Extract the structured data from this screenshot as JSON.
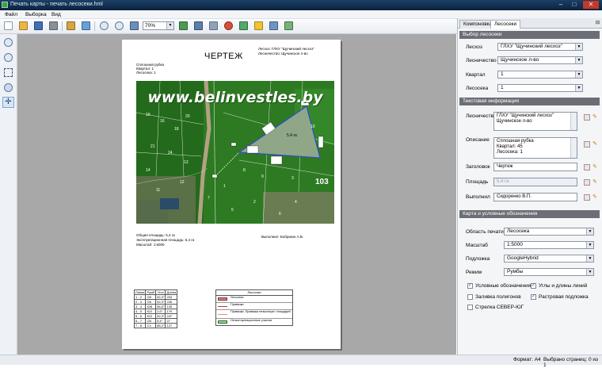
{
  "window": {
    "title": "Печать карты - печать лесосеки.hml",
    "minimize": "–",
    "maximize": "□",
    "close": "✕"
  },
  "menu": [
    "Файл",
    "Выборка",
    "Вид"
  ],
  "toolbar": {
    "zoom_value": "70%"
  },
  "page": {
    "heading": "ЧЕРТЕЖ",
    "leshoz_line": "Лесхоз: ГЛХУ \"Щучинский лесхоз\"",
    "lesnichestvo_line": "Лесничество: Щучинское л-во",
    "desc_lines": [
      "Сплошная рубка",
      "Квартал: 1",
      "Лесосека: 1"
    ],
    "watermark": "www.belinvestles.by",
    "map_labels": [
      "19",
      "16",
      "18",
      "20",
      "21",
      "24",
      "14",
      "13",
      "12",
      "11",
      "1",
      "2",
      "3",
      "4",
      "5",
      "6",
      "7",
      "8",
      "9",
      "10",
      "103",
      "5,4 га"
    ],
    "area_total": "Общая площадь: 5,4 га",
    "area_expl": "Эксплуатационная площадь: 5,4 га",
    "scale": "Масштаб: 1:5000",
    "executor": "Выполнил: Бобрикок А.В.",
    "bearing_table": {
      "headers": [
        "Линия",
        "Румб",
        "Угол",
        "Длина"
      ],
      "rows": [
        [
          "1 - 2",
          "СВ",
          "52,3°",
          "203"
        ],
        [
          "2 - 3",
          "СВ",
          "52,3°",
          "226"
        ],
        [
          "3 - 4",
          "ЮВ",
          "56,5°",
          "139"
        ],
        [
          "4 - 5",
          "ЮЗ",
          "2,5°",
          "179"
        ],
        [
          "5 - 6",
          "ЮЗ",
          "52,3°",
          "247"
        ],
        [
          "6 - 7",
          "СВ",
          "5,4°",
          "27"
        ],
        [
          "7 - 8",
          "СЗ",
          "88,2°",
          "127"
        ]
      ]
    },
    "legend": {
      "title": "Лесосеки",
      "items": [
        "Лесосеки",
        "Привязки",
        "Привязки. Привязки неэксплуат. площадей",
        "Неэксплуатационные участки"
      ]
    }
  },
  "panel": {
    "tabs": [
      "Компоновка",
      "Лесосеки"
    ],
    "sections": {
      "select": "Выбор лесосеки",
      "text_info": "Текстовая информация",
      "map": "Карта и условные обозначения"
    },
    "select_fields": [
      {
        "label": "Лесхоз",
        "value": "ГЛХУ \"Щучинский лесхоз\""
      },
      {
        "label": "Лесничество",
        "value": "Щучинское л-во"
      },
      {
        "label": "Квартал",
        "value": "1"
      },
      {
        "label": "Лесосека",
        "value": "1"
      }
    ],
    "text_fields": {
      "lesnichestvo_label": "Лесничество",
      "lesnichestvo_value_1": "ГЛХУ \"Щучинский лесхоз\"",
      "lesnichestvo_value_2": "Щучинское л-во",
      "opisanie_label": "Описание",
      "opisanie_lines": [
        "Сплошная рубка",
        "Квартал: 45",
        "Лесосека: 1"
      ],
      "zagolovok_label": "Заголовок",
      "zagolovok_value": "Чертеж",
      "ploshad_label": "Площадь",
      "ploshad_value": "5,4 га",
      "vypolnil_label": "Выполнил",
      "vypolnil_value": "Сидоренко В.П."
    },
    "map_fields": [
      {
        "label": "Область печати",
        "value": "Лесосека"
      },
      {
        "label": "Масштаб",
        "value": "1:5000"
      },
      {
        "label": "Подложка",
        "value": "GoogleHybrid"
      },
      {
        "label": "Режим",
        "value": "Румбы"
      }
    ],
    "checkboxes": [
      {
        "label": "Условные обозначения",
        "checked": true
      },
      {
        "label": "Углы и длины линий",
        "checked": true
      },
      {
        "label": "Заливка полигонов",
        "checked": false
      },
      {
        "label": "Растровая подложка",
        "checked": true
      },
      {
        "label": "Стрелка СЕВЕР-ЮГ",
        "checked": false
      }
    ]
  },
  "status": {
    "format": "Формат: А4",
    "selected_pages": "Выбрано страниц: 0 из 1"
  }
}
